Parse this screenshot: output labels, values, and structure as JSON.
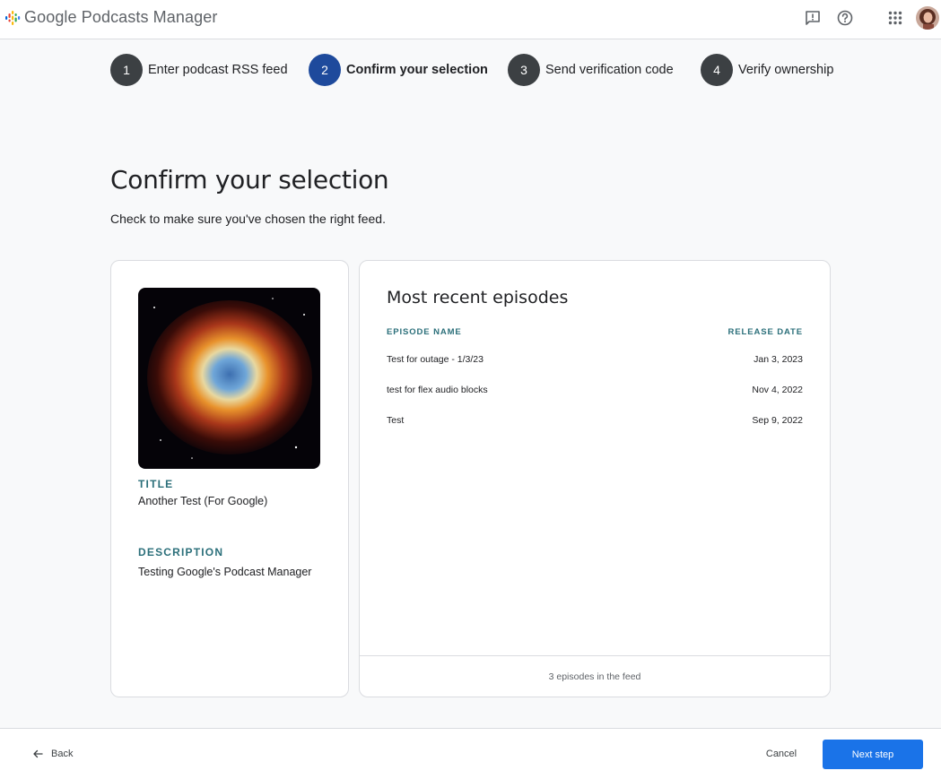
{
  "app": {
    "title": "Google Podcasts Manager"
  },
  "header": {
    "icons": [
      "feedback-icon",
      "help-icon",
      "apps-grid-icon"
    ],
    "avatar": "user-avatar"
  },
  "stepper": [
    {
      "number": "1",
      "label": "Enter podcast RSS feed",
      "active": false
    },
    {
      "number": "2",
      "label": "Confirm your selection",
      "active": true
    },
    {
      "number": "3",
      "label": "Send verification code",
      "active": false
    },
    {
      "number": "4",
      "label": "Verify ownership",
      "active": false
    }
  ],
  "main": {
    "title": "Confirm your selection",
    "subtitle": "Check to make sure you've chosen the right feed."
  },
  "podcast": {
    "title_label": "TITLE",
    "title": "Another Test (For Google)",
    "description_label": "DESCRIPTION",
    "description": "Testing Google's Podcast Manager"
  },
  "episodes": {
    "heading": "Most recent episodes",
    "columns": {
      "name": "EPISODE NAME",
      "date": "RELEASE DATE"
    },
    "rows": [
      {
        "name": "Test for outage - 1/3/23",
        "date": "Jan 3, 2023"
      },
      {
        "name": "test for flex audio blocks",
        "date": "Nov 4, 2022"
      },
      {
        "name": "Test",
        "date": "Sep 9, 2022"
      }
    ],
    "footer": "3 episodes in the feed"
  },
  "footer": {
    "back_label": "Back",
    "cancel_label": "Cancel",
    "next_label": "Next step"
  },
  "colors": {
    "accent": "#1a73e8",
    "active_step": "#1e4a9c",
    "label_teal": "#2b6f7a"
  }
}
